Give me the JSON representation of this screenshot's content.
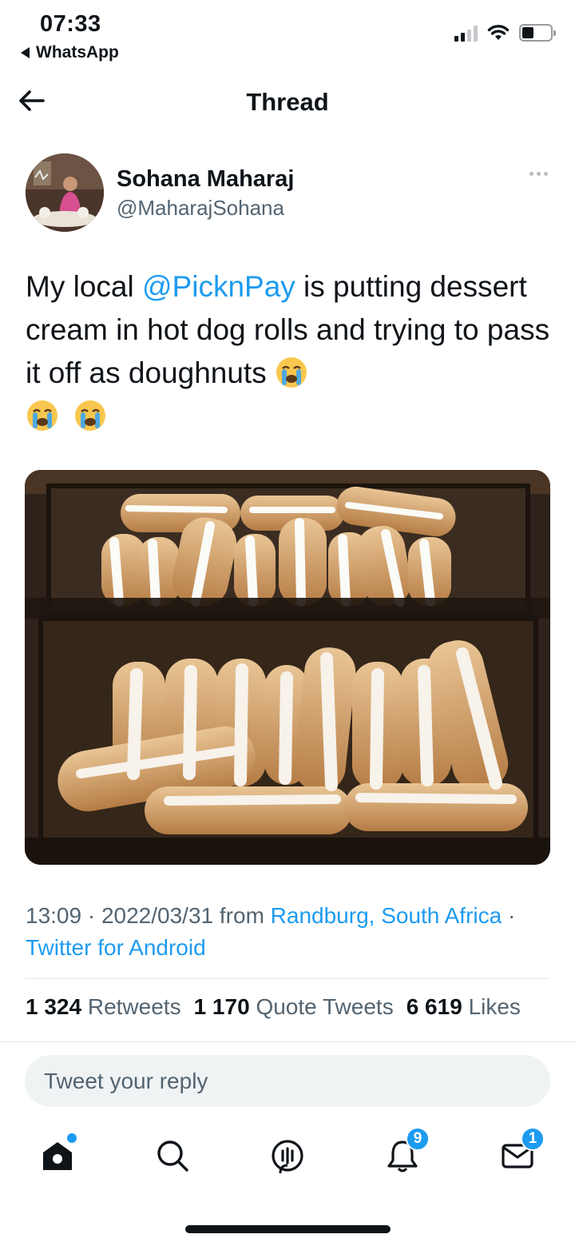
{
  "status_bar": {
    "time": "07:33",
    "back_app": "WhatsApp",
    "battery_level": 0.4,
    "signal_bars": 2
  },
  "header": {
    "title": "Thread"
  },
  "tweet": {
    "author_name": "Sohana Maharaj",
    "author_handle": "@MaharajSohana",
    "text_before": "My local ",
    "mention": "@PicknPay",
    "text_after": " is putting dessert cream in hot dog rolls and trying to pass it off as doughnuts ",
    "emoji_name": "loudly-crying-face",
    "emoji_count": 3,
    "time": "13:09",
    "date": "2022/03/31",
    "from_word": "from",
    "location": "Randburg, South Africa",
    "source": "Twitter for Android",
    "separator": " · "
  },
  "stats": {
    "retweets_count": "1 324",
    "retweets_label": "Retweets",
    "quotes_count": "1 170",
    "quotes_label": "Quote Tweets",
    "likes_count": "6 619",
    "likes_label": "Likes"
  },
  "reply": {
    "placeholder": "Tweet your reply"
  },
  "tabbar": {
    "notifications_badge": "9",
    "messages_badge": "1"
  },
  "colors": {
    "accent": "#1d9bf0",
    "text": "#0f1419",
    "secondary": "#536471"
  }
}
